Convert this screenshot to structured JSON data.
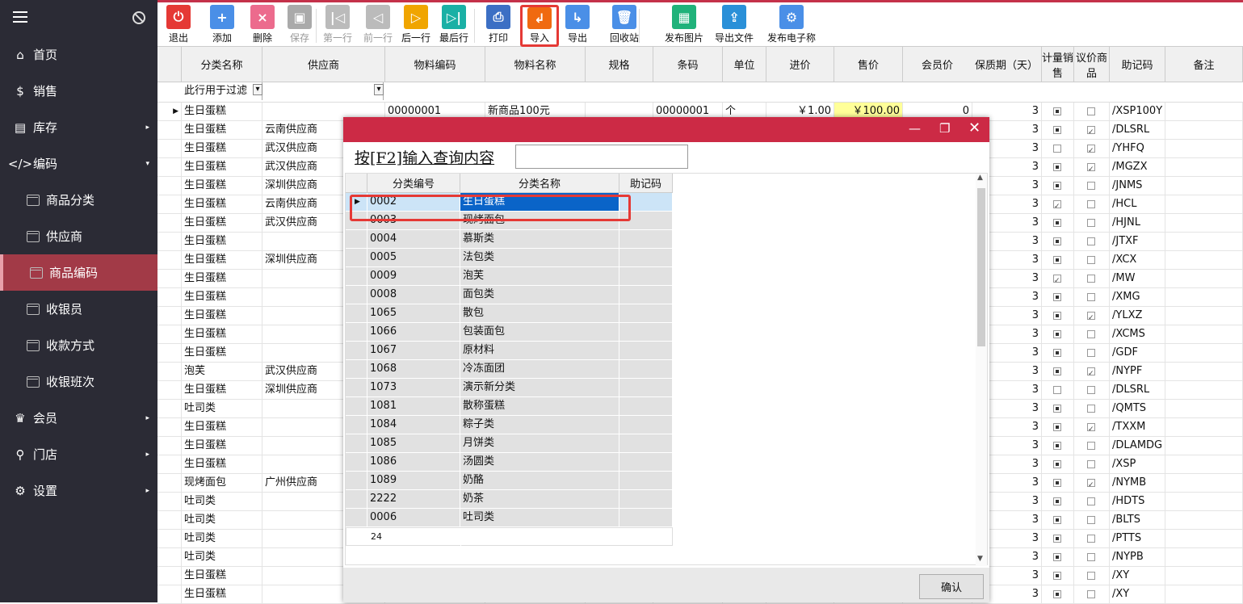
{
  "sidebar": {
    "items": [
      {
        "label": "首页",
        "icon": "home-icon",
        "glyph": "⌂"
      },
      {
        "label": "销售",
        "icon": "dollar-icon",
        "glyph": "$"
      },
      {
        "label": "库存",
        "icon": "storage-icon",
        "glyph": "▤"
      },
      {
        "label": "编码",
        "icon": "code-icon",
        "glyph": "</>"
      },
      {
        "label": "商品分类",
        "icon": "window-icon"
      },
      {
        "label": "供应商",
        "icon": "window-icon"
      },
      {
        "label": "商品编码",
        "icon": "window-icon"
      },
      {
        "label": "收银员",
        "icon": "window-icon"
      },
      {
        "label": "收款方式",
        "icon": "window-icon"
      },
      {
        "label": "收银班次",
        "icon": "window-icon"
      },
      {
        "label": "会员",
        "icon": "crown-icon",
        "glyph": "♛"
      },
      {
        "label": "门店",
        "icon": "search-icon",
        "glyph": "⚲"
      },
      {
        "label": "设置",
        "icon": "gear-icon",
        "glyph": "⚙"
      }
    ]
  },
  "toolbar": {
    "buttons": [
      {
        "label": "退出",
        "icon": "power-icon",
        "glyph": "⏻",
        "color": "#e53935"
      },
      {
        "label": "添加",
        "icon": "plus-icon",
        "glyph": "+",
        "color": "#4a8fe7"
      },
      {
        "label": "删除",
        "icon": "delete-icon",
        "glyph": "×",
        "color": "#ec6b8d"
      },
      {
        "label": "保存",
        "icon": "save-icon",
        "glyph": "▣",
        "color": "#aaaaaa"
      },
      {
        "label": "第一行",
        "icon": "first-row-icon",
        "glyph": "|◁",
        "color": "#bbbbbb"
      },
      {
        "label": "前一行",
        "icon": "prev-row-icon",
        "glyph": "◁",
        "color": "#bbbbbb"
      },
      {
        "label": "后一行",
        "icon": "next-row-icon",
        "glyph": "▷",
        "color": "#f0a500"
      },
      {
        "label": "最后行",
        "icon": "last-row-icon",
        "glyph": "▷|",
        "color": "#1ab0a5"
      },
      {
        "label": "打印",
        "icon": "print-icon",
        "glyph": "⎙",
        "color": "#3c6fc4"
      },
      {
        "label": "导入",
        "icon": "import-icon",
        "glyph": "↲",
        "color": "#f06a10"
      },
      {
        "label": "导出",
        "icon": "export-icon",
        "glyph": "↳",
        "color": "#4a8fe7"
      },
      {
        "label": "回收站",
        "icon": "trash-icon",
        "glyph": "🗑",
        "color": "#4a8fe7"
      },
      {
        "label": "发布图片",
        "icon": "image-icon",
        "glyph": "▦",
        "color": "#20b27a"
      },
      {
        "label": "导出文件",
        "icon": "export-file-icon",
        "glyph": "⇪",
        "color": "#2a90d8"
      },
      {
        "label": "发布电子称",
        "icon": "scale-settings-icon",
        "glyph": "⚙",
        "color": "#4a8fe7"
      }
    ]
  },
  "grid": {
    "headers": [
      "分类名称",
      "供应商",
      "物料编码",
      "物料名称",
      "规格",
      "条码",
      "单位",
      "进价",
      "售价",
      "会员价",
      "保质期（天）",
      "计量销售",
      "议价商品",
      "助记码",
      "备注"
    ],
    "filter_placeholder": "此行用于过滤",
    "rows": [
      {
        "cat": "生日蛋糕",
        "sup": "",
        "code": "00000001",
        "name": "新商品100元",
        "barcode": "00000001",
        "unit": "个",
        "buy": "￥1.00",
        "sell": "￥100.00",
        "member": "0",
        "shelf": "3",
        "weigh": "fill",
        "bargain": "empty",
        "mnemonic": "/XSP100Y"
      },
      {
        "cat": "生日蛋糕",
        "sup": "云南供应商",
        "shelf": "3",
        "weigh": "fill",
        "bargain": "chk",
        "mnemonic": "/DLSRL"
      },
      {
        "cat": "生日蛋糕",
        "sup": "武汉供应商",
        "shelf": "3",
        "weigh": "empty",
        "bargain": "chk",
        "mnemonic": "/YHFQ"
      },
      {
        "cat": "生日蛋糕",
        "sup": "武汉供应商",
        "shelf": "3",
        "weigh": "fill",
        "bargain": "chk",
        "mnemonic": "/MGZX"
      },
      {
        "cat": "生日蛋糕",
        "sup": "深圳供应商",
        "shelf": "3",
        "weigh": "fill",
        "bargain": "empty",
        "mnemonic": "/JNMS"
      },
      {
        "cat": "生日蛋糕",
        "sup": "云南供应商",
        "shelf": "3",
        "weigh": "chk",
        "bargain": "empty",
        "mnemonic": "/HCL"
      },
      {
        "cat": "生日蛋糕",
        "sup": "武汉供应商",
        "shelf": "3",
        "weigh": "fill",
        "bargain": "empty",
        "mnemonic": "/HJNL"
      },
      {
        "cat": "生日蛋糕",
        "sup": "",
        "shelf": "3",
        "weigh": "fill",
        "bargain": "empty",
        "mnemonic": "/JTXF"
      },
      {
        "cat": "生日蛋糕",
        "sup": "深圳供应商",
        "shelf": "3",
        "weigh": "fill",
        "bargain": "empty",
        "mnemonic": "/XCX"
      },
      {
        "cat": "生日蛋糕",
        "sup": "",
        "shelf": "3",
        "weigh": "chk",
        "bargain": "empty",
        "mnemonic": "/MW"
      },
      {
        "cat": "生日蛋糕",
        "sup": "",
        "shelf": "3",
        "weigh": "fill",
        "bargain": "empty",
        "mnemonic": "/XMG"
      },
      {
        "cat": "生日蛋糕",
        "sup": "",
        "shelf": "3",
        "weigh": "fill",
        "bargain": "chk",
        "mnemonic": "/YLXZ"
      },
      {
        "cat": "生日蛋糕",
        "sup": "",
        "shelf": "3",
        "weigh": "fill",
        "bargain": "empty",
        "mnemonic": "/XCMS"
      },
      {
        "cat": "生日蛋糕",
        "sup": "",
        "shelf": "3",
        "weigh": "fill",
        "bargain": "empty",
        "mnemonic": "/GDF"
      },
      {
        "cat": "泡芙",
        "sup": "武汉供应商",
        "shelf": "3",
        "weigh": "fill",
        "bargain": "chk",
        "mnemonic": "/NYPF"
      },
      {
        "cat": "生日蛋糕",
        "sup": "深圳供应商",
        "shelf": "3",
        "weigh": "empty",
        "bargain": "empty",
        "mnemonic": "/DLSRL"
      },
      {
        "cat": "吐司类",
        "sup": "",
        "shelf": "3",
        "weigh": "fill",
        "bargain": "empty",
        "mnemonic": "/QMTS"
      },
      {
        "cat": "生日蛋糕",
        "sup": "",
        "shelf": "3",
        "weigh": "fill",
        "bargain": "chk",
        "mnemonic": "/TXXM"
      },
      {
        "cat": "生日蛋糕",
        "sup": "",
        "shelf": "3",
        "weigh": "fill",
        "bargain": "empty",
        "mnemonic": "/DLAMDG"
      },
      {
        "cat": "生日蛋糕",
        "sup": "",
        "shelf": "3",
        "weigh": "fill",
        "bargain": "empty",
        "mnemonic": "/XSP"
      },
      {
        "cat": "现烤面包",
        "sup": "广州供应商",
        "shelf": "3",
        "weigh": "fill",
        "bargain": "chk",
        "mnemonic": "/NYMB"
      },
      {
        "cat": "吐司类",
        "sup": "",
        "shelf": "3",
        "weigh": "fill",
        "bargain": "empty",
        "mnemonic": "/HDTS"
      },
      {
        "cat": "吐司类",
        "sup": "",
        "shelf": "3",
        "weigh": "fill",
        "bargain": "empty",
        "mnemonic": "/BLTS"
      },
      {
        "cat": "吐司类",
        "sup": "",
        "shelf": "3",
        "weigh": "fill",
        "bargain": "empty",
        "mnemonic": "/PTTS"
      },
      {
        "cat": "吐司类",
        "sup": "",
        "shelf": "3",
        "weigh": "fill",
        "bargain": "empty",
        "mnemonic": "/NYPB"
      },
      {
        "cat": "生日蛋糕",
        "sup": "",
        "shelf": "3",
        "weigh": "fill",
        "bargain": "empty",
        "mnemonic": "/XY"
      },
      {
        "cat": "生日蛋糕",
        "sup": "",
        "shelf": "3",
        "weigh": "fill",
        "bargain": "empty",
        "mnemonic": "/XY"
      }
    ]
  },
  "dialog": {
    "search_label": "按[F2]输入查询内容",
    "search_value": "",
    "headers": [
      "分类编号",
      "分类名称",
      "助记码"
    ],
    "rows": [
      {
        "code": "0002",
        "name": "生日蛋糕"
      },
      {
        "code": "0003",
        "name": "现烤面包"
      },
      {
        "code": "0004",
        "name": "慕斯类"
      },
      {
        "code": "0005",
        "name": "法包类"
      },
      {
        "code": "0009",
        "name": "泡芙"
      },
      {
        "code": "0008",
        "name": "面包类"
      },
      {
        "code": "1065",
        "name": "散包"
      },
      {
        "code": "1066",
        "name": "包装面包"
      },
      {
        "code": "1067",
        "name": "原材料"
      },
      {
        "code": "1068",
        "name": "冷冻面团"
      },
      {
        "code": "1073",
        "name": "演示新分类"
      },
      {
        "code": "1081",
        "name": "散称蛋糕"
      },
      {
        "code": "1084",
        "name": "粽子类"
      },
      {
        "code": "1085",
        "name": "月饼类"
      },
      {
        "code": "1086",
        "name": "汤圆类"
      },
      {
        "code": "1089",
        "name": "奶酪"
      },
      {
        "code": "2222",
        "name": "奶茶"
      },
      {
        "code": "0006",
        "name": "吐司类"
      }
    ],
    "count": "24",
    "ok_label": "确认"
  }
}
